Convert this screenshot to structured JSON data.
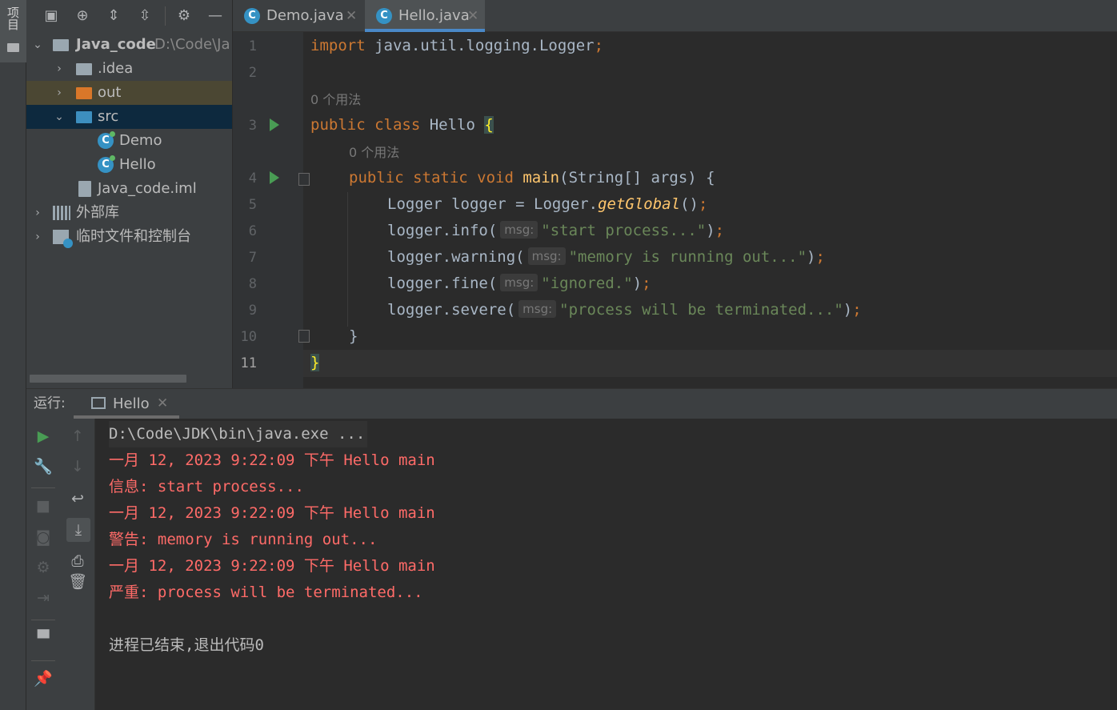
{
  "tool_strip": {
    "project_tab_label": "项目"
  },
  "project": {
    "tree": [
      {
        "label": "Java_code",
        "path": "D:\\Code\\Ja",
        "type": "module",
        "expanded": true
      },
      {
        "label": ".idea",
        "type": "folder",
        "expanded": false
      },
      {
        "label": "out",
        "type": "folder-excluded",
        "expanded": false
      },
      {
        "label": "src",
        "type": "source-folder",
        "expanded": true
      },
      {
        "label": "Demo",
        "type": "class"
      },
      {
        "label": "Hello",
        "type": "class"
      },
      {
        "label": "Java_code.iml",
        "type": "iml-file"
      },
      {
        "label": "外部库",
        "type": "libraries",
        "expanded": false
      },
      {
        "label": "临时文件和控制台",
        "type": "scratches",
        "expanded": false
      }
    ]
  },
  "editor": {
    "tabs": [
      {
        "label": "Demo.java",
        "active": false
      },
      {
        "label": "Hello.java",
        "active": true
      }
    ],
    "line_numbers": [
      "1",
      "2",
      "3",
      "4",
      "5",
      "6",
      "7",
      "8",
      "9",
      "10",
      "11"
    ],
    "usage_hints": {
      "class": "0 个用法",
      "method": "0 个用法"
    },
    "code": {
      "l1_kw": "import",
      "l1_rest": " java.util.logging.Logger",
      "l1_semi": ";",
      "l3_kw": "public class",
      "l3_name": " Hello ",
      "l3_brace": "{",
      "l4_kw": "public static void",
      "l4_fn": "main",
      "l4_rest": "(String[] args) {",
      "l5_a": "Logger logger = Logger.",
      "l5_it": "getGlobal",
      "l5_b": "()",
      "l5_semi": ";",
      "l6_a": "logger.info(",
      "l6_str": "\"start process...\"",
      "l6_b": ")",
      "l7_a": "logger.warning(",
      "l7_str": "\"memory is running out...\"",
      "l7_b": ")",
      "l8_a": "logger.fine(",
      "l8_str": "\"ignored.\"",
      "l8_b": ")",
      "l9_a": "logger.severe(",
      "l9_str": "\"process will be terminated...\"",
      "l9_b": ")",
      "semi": ";",
      "param_hint": "msg:",
      "l10": "}",
      "l11": "}"
    }
  },
  "run": {
    "label": "运行:",
    "tab_label": "Hello",
    "console": [
      {
        "text": "D:\\Code\\JDK\\bin\\java.exe ...",
        "kind": "cmd"
      },
      {
        "text": "一月 12, 2023 9:22:09 下午 Hello main",
        "kind": "err"
      },
      {
        "text": "信息: start process...",
        "kind": "err"
      },
      {
        "text": "一月 12, 2023 9:22:09 下午 Hello main",
        "kind": "err"
      },
      {
        "text": "警告: memory is running out...",
        "kind": "err"
      },
      {
        "text": "一月 12, 2023 9:22:09 下午 Hello main",
        "kind": "err"
      },
      {
        "text": "严重: process will be terminated...",
        "kind": "err"
      },
      {
        "text": "",
        "kind": "blank"
      },
      {
        "text": "进程已结束,退出代码0",
        "kind": "exit"
      }
    ]
  },
  "colors": {
    "keyword": "#cc7832",
    "string": "#6a8759",
    "method": "#ffc66d",
    "console_error": "#ff6b68",
    "run_green": "#499c54",
    "selection_blue": "#0d293e",
    "tab_underline": "#4a88c7"
  }
}
